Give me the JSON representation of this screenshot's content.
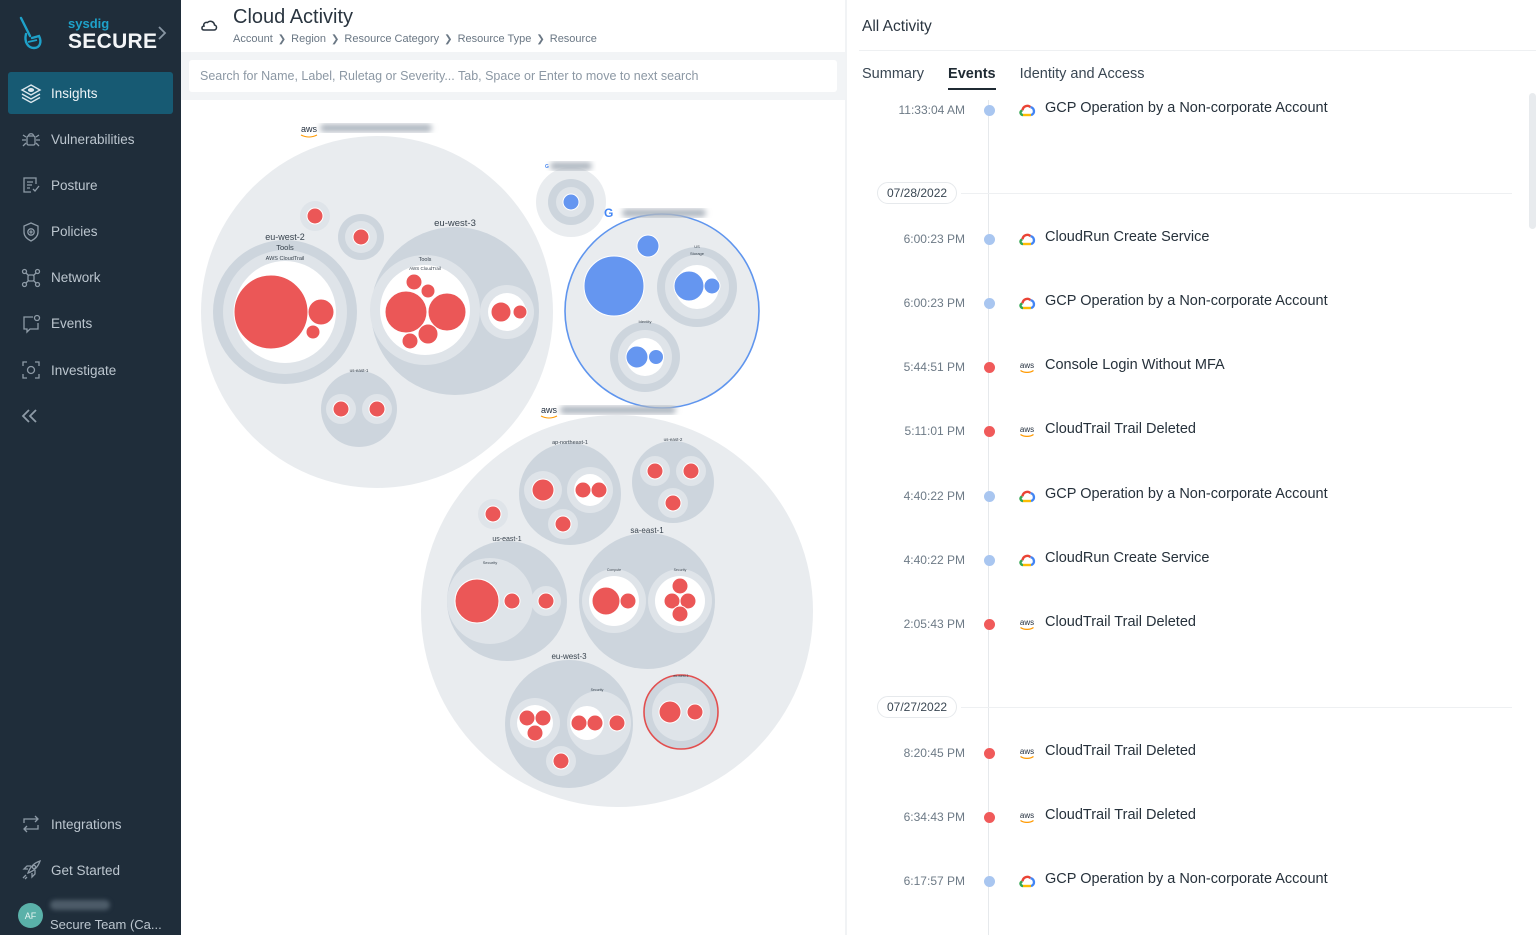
{
  "brand": {
    "small": "sysdig",
    "big": "SECURE"
  },
  "sidebar": {
    "items": [
      {
        "label": "Insights",
        "icon": "layers-icon",
        "active": true
      },
      {
        "label": "Vulnerabilities",
        "icon": "bug-icon"
      },
      {
        "label": "Posture",
        "icon": "checklist-icon"
      },
      {
        "label": "Policies",
        "icon": "shield-plus-icon"
      },
      {
        "label": "Network",
        "icon": "network-icon"
      },
      {
        "label": "Events",
        "icon": "chat-alert-icon"
      },
      {
        "label": "Investigate",
        "icon": "scan-icon"
      }
    ],
    "bottom_items": [
      {
        "label": "Integrations",
        "icon": "swap-arrows-icon"
      },
      {
        "label": "Get Started",
        "icon": "rocket-icon"
      }
    ],
    "user": {
      "initials": "AF",
      "team": "Secure Team (Ca..."
    }
  },
  "header": {
    "title": "Cloud Activity",
    "breadcrumb": [
      "Account",
      "Region",
      "Resource Category",
      "Resource Type",
      "Resource"
    ]
  },
  "search": {
    "value": "",
    "placeholder": "Search for Name, Label, Ruletag or Severity... Tab, Space or Enter to move to next search"
  },
  "bubble_map": {
    "colors": {
      "aws_event": "#eb5757",
      "gcp_event": "#6596f0",
      "outer": "#e9ecef",
      "region": "#cdd5dd",
      "category": "#dfe4e9",
      "type": "#ffffff",
      "gcp_border": "#5f95ee",
      "selected_border": "#e24f4f"
    },
    "labels": {
      "aws1_eu_west_2": "eu-west-2",
      "aws1_tools": "Tools",
      "aws1_cloudtrail": "AWS CloudTrail",
      "aws1_eu_west_3": "eu-west-3",
      "aws1_tools2": "Tools",
      "aws1_cloudtrail2": "AWS CloudTrail",
      "aws1_us_east_1": "us-east-1",
      "gcp2_us": "US",
      "gcp2_storage": "Storage",
      "gcp2_identity": "Identity",
      "aws2_ap_northeast_1": "ap-northeast-1",
      "aws2_us_east_2": "us-east-2",
      "aws2_us_east_1": "us-east-1",
      "aws2_security": "Security",
      "aws2_sa_east_1": "sa-east-1",
      "aws2_compute": "Compute",
      "aws2_security2": "Security",
      "aws2_eu_west_3": "eu-west-3",
      "aws2_security3": "Security",
      "aws2_eu_west_1": "eu-west-1",
      "aws_logo": "aws"
    }
  },
  "right_panel": {
    "title": "All Activity",
    "tabs": [
      {
        "label": "Summary"
      },
      {
        "label": "Events",
        "active": true
      },
      {
        "label": "Identity and Access"
      }
    ],
    "dates": [
      "07/28/2022",
      "07/27/2022"
    ],
    "events": [
      {
        "time": "11:33:04 AM",
        "provider": "gcp",
        "severity": "low",
        "label": "GCP Operation by a Non-corporate Account"
      },
      {
        "time": "6:00:23 PM",
        "provider": "gcp",
        "severity": "low",
        "label": "CloudRun Create Service"
      },
      {
        "time": "6:00:23 PM",
        "provider": "gcp",
        "severity": "low",
        "label": "GCP Operation by a Non-corporate Account"
      },
      {
        "time": "5:44:51 PM",
        "provider": "aws",
        "severity": "high",
        "label": "Console Login Without MFA"
      },
      {
        "time": "5:11:01 PM",
        "provider": "aws",
        "severity": "high",
        "label": "CloudTrail Trail Deleted"
      },
      {
        "time": "4:40:22 PM",
        "provider": "gcp",
        "severity": "low",
        "label": "GCP Operation by a Non-corporate Account"
      },
      {
        "time": "4:40:22 PM",
        "provider": "gcp",
        "severity": "low",
        "label": "CloudRun Create Service"
      },
      {
        "time": "2:05:43 PM",
        "provider": "aws",
        "severity": "high",
        "label": "CloudTrail Trail Deleted"
      },
      {
        "time": "8:20:45 PM",
        "provider": "aws",
        "severity": "high",
        "label": "CloudTrail Trail Deleted"
      },
      {
        "time": "6:34:43 PM",
        "provider": "aws",
        "severity": "high",
        "label": "CloudTrail Trail Deleted"
      },
      {
        "time": "6:17:57 PM",
        "provider": "gcp",
        "severity": "low",
        "label": "GCP Operation by a Non-corporate Account"
      }
    ],
    "severity_colors": {
      "high": "#f05a5a",
      "low": "#a9c6f0"
    }
  }
}
